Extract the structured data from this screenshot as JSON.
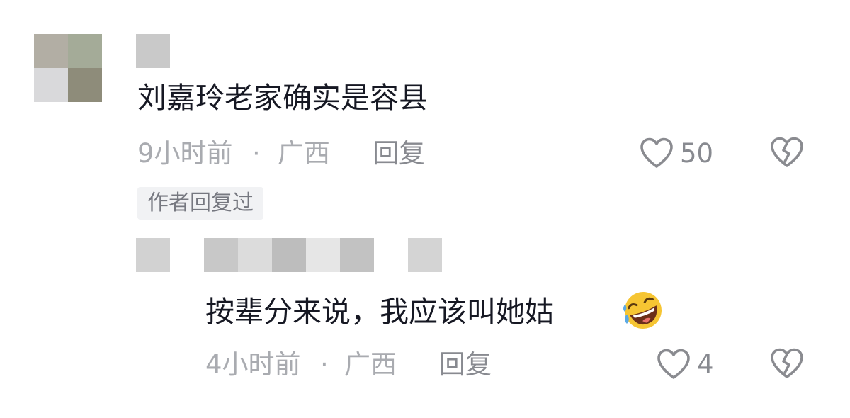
{
  "comments": [
    {
      "text": "刘嘉玲老家确实是容县",
      "time": "9小时前",
      "separator": "·",
      "location": "广西",
      "reply_label": "回复",
      "likes": "50",
      "author_badge": "作者回复过"
    },
    {
      "text": "按辈分来说，我应该叫她姑",
      "emoji": "rolling-on-the-floor-laughing",
      "time": "4小时前",
      "separator": "·",
      "location": "广西",
      "reply_label": "回复",
      "likes": "4"
    }
  ],
  "icons": {
    "like": "heart-outline-icon",
    "dislike": "broken-heart-outline-icon"
  },
  "colors": {
    "text": "#161823",
    "meta": "#a9abb0",
    "icon": "#8a8b90",
    "badge_bg": "#f1f2f4"
  }
}
